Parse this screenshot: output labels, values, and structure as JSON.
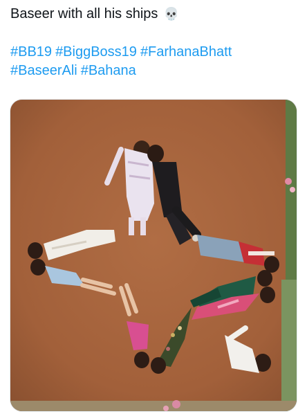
{
  "post": {
    "text": "Baseer with all his ships",
    "emoji": "💀",
    "emoji_name": "skull-icon",
    "hashtags": [
      "#BB19",
      "#BiggBoss19",
      "#FarhanaBhatt",
      "#BaseerAli",
      "#Bahana"
    ]
  },
  "colors": {
    "hashtag": "#1d9bf0",
    "text": "#0f1419",
    "carpet": "#a8663f"
  }
}
